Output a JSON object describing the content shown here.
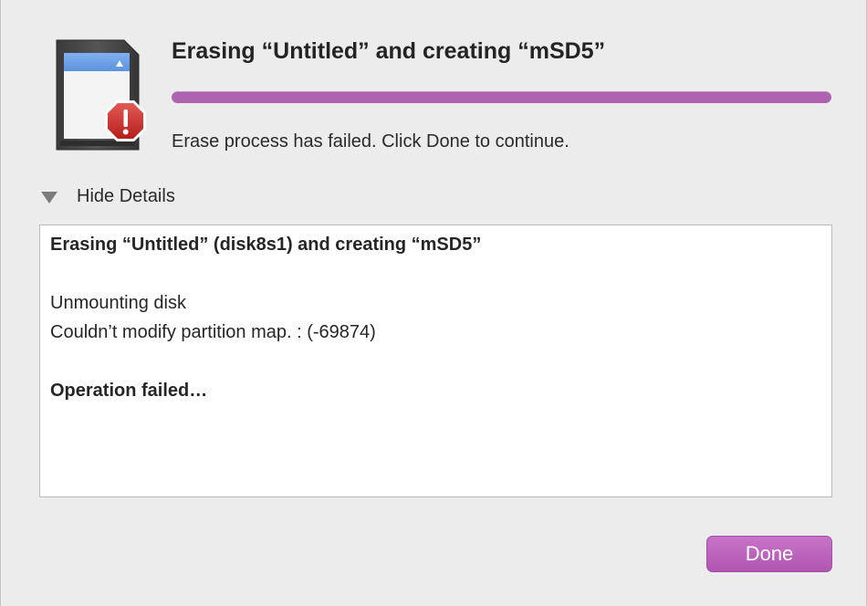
{
  "dialog": {
    "title": "Erasing “Untitled” and creating “mSD5”",
    "status_message": "Erase process has failed. Click Done to continue.",
    "progress_fraction": 1.0,
    "progress_color": "#ad63b0",
    "icon": "sd-card-icon",
    "alert_icon": "alert-exclamation-icon"
  },
  "details": {
    "toggle_label": "Hide Details",
    "toggle_icon": "disclosure-triangle-down-icon",
    "log": {
      "heading": "Erasing “Untitled” (disk8s1) and creating “mSD5”",
      "line1": "Unmounting disk",
      "line2": "Couldn’t modify partition map. : (-69874)",
      "result": "Operation failed…"
    }
  },
  "buttons": {
    "done_label": "Done",
    "accent_color": "#b85fba"
  }
}
